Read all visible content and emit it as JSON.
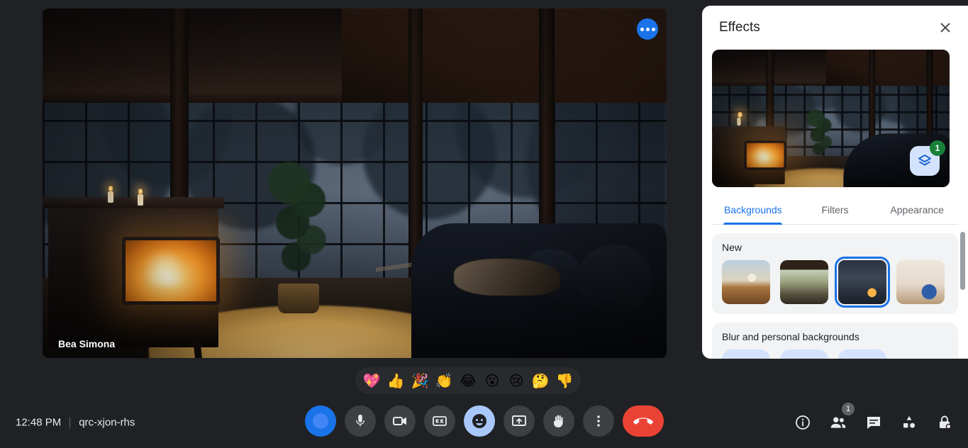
{
  "meeting": {
    "time": "12:48 PM",
    "code": "qrc-xjon-rhs",
    "participant_name": "Bea Simona",
    "more_options_label": "More options"
  },
  "colors": {
    "page_background": "#202124",
    "accent_blue": "#1a73e8",
    "active_control": "#a8c7fa",
    "hangup_red": "#ea4335",
    "badge_green": "#188038",
    "panel_background": "#ffffff"
  },
  "reactions": [
    {
      "name": "sparkling-heart",
      "glyph": "💖"
    },
    {
      "name": "thumbs-up",
      "glyph": "👍"
    },
    {
      "name": "party-popper",
      "glyph": "🎉"
    },
    {
      "name": "clapping-hands",
      "glyph": "👏"
    },
    {
      "name": "face-with-tears-of-joy",
      "glyph": "😂"
    },
    {
      "name": "face-with-open-mouth",
      "glyph": "😮"
    },
    {
      "name": "crying-face",
      "glyph": "😢"
    },
    {
      "name": "thinking-face",
      "glyph": "🤔"
    },
    {
      "name": "thumbs-down",
      "glyph": "👎"
    }
  ],
  "controls": [
    {
      "name": "user-avatar-button",
      "label": "Profile",
      "icon": "avatar-circle"
    },
    {
      "name": "microphone-button",
      "label": "Turn off microphone",
      "icon": "microphone-icon"
    },
    {
      "name": "camera-button",
      "label": "Turn off camera",
      "icon": "video-camera-icon"
    },
    {
      "name": "captions-button",
      "label": "Turn on captions",
      "icon": "closed-captions-icon"
    },
    {
      "name": "effects-button",
      "label": "Apply visual effects",
      "icon": "smiley-face-icon"
    },
    {
      "name": "present-button",
      "label": "Present now",
      "icon": "present-screen-icon"
    },
    {
      "name": "raise-hand-button",
      "label": "Raise hand",
      "icon": "raised-hand-icon"
    },
    {
      "name": "more-options-button",
      "label": "More options",
      "icon": "three-dots-vertical-icon"
    },
    {
      "name": "leave-call-button",
      "label": "Leave call",
      "icon": "end-call-icon"
    }
  ],
  "right_icons": [
    {
      "name": "meeting-details-button",
      "label": "Meeting details",
      "icon": "info-icon",
      "badge": ""
    },
    {
      "name": "people-button",
      "label": "People",
      "icon": "people-icon",
      "badge": "1"
    },
    {
      "name": "chat-button",
      "label": "Chat with everyone",
      "icon": "chat-bubble-icon",
      "badge": ""
    },
    {
      "name": "activities-button",
      "label": "Activities",
      "icon": "activities-shapes-icon",
      "badge": ""
    },
    {
      "name": "host-controls-button",
      "label": "Host controls",
      "icon": "lock-icon",
      "badge": ""
    }
  ],
  "effects_panel": {
    "title": "Effects",
    "close_label": "Close",
    "preview": {
      "layers_button_label": "Layers",
      "layers_badge": "1"
    },
    "tabs": [
      {
        "name": "tab-backgrounds",
        "label": "Backgrounds",
        "selected": true
      },
      {
        "name": "tab-filters",
        "label": "Filters",
        "selected": false
      },
      {
        "name": "tab-appearance",
        "label": "Appearance",
        "selected": false
      }
    ],
    "groups": [
      {
        "name": "new-backgrounds-group",
        "title": "New",
        "thumbnails": [
          {
            "name": "background-thumb-taj-terrace",
            "style": "t-taj",
            "selected": false
          },
          {
            "name": "background-thumb-pergola-patio",
            "style": "t-pergola",
            "selected": false
          },
          {
            "name": "background-thumb-cabin-fireplace",
            "style": "t-cabin",
            "selected": true
          },
          {
            "name": "background-thumb-living-room",
            "style": "t-livingroom",
            "selected": false
          }
        ]
      },
      {
        "name": "blur-and-personal-backgrounds-group",
        "title": "Blur and personal backgrounds",
        "chips": [
          {
            "name": "blur-option-1"
          },
          {
            "name": "blur-option-2"
          },
          {
            "name": "blur-option-3"
          }
        ]
      }
    ]
  }
}
